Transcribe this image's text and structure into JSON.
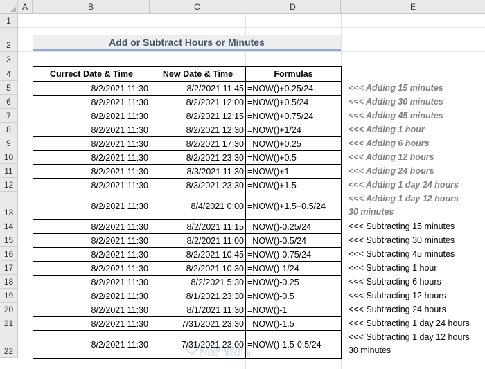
{
  "columns": [
    "A",
    "B",
    "C",
    "D",
    "E"
  ],
  "rows": [
    "1",
    "2",
    "3",
    "4",
    "5",
    "6",
    "7",
    "8",
    "9",
    "10",
    "11",
    "12",
    "13",
    "14",
    "15",
    "16",
    "17",
    "18",
    "19",
    "20",
    "21",
    "22"
  ],
  "title": "Add or Subtract Hours or Minutes",
  "table": {
    "headers": [
      "Currect Date & Time",
      "New Date & Time",
      "Formulas"
    ],
    "rows": [
      {
        "current": "8/2/2021 11:30",
        "new": "8/2/2021 11:45",
        "formula": "=NOW()+0.25/24",
        "note": "<<< Adding 15 minutes"
      },
      {
        "current": "8/2/2021 11:30",
        "new": "8/2/2021 12:00",
        "formula": "=NOW()+0.5/24",
        "note": "<<< Adding 30 minutes"
      },
      {
        "current": "8/2/2021 11:30",
        "new": "8/2/2021 12:15",
        "formula": "=NOW()+0.75/24",
        "note": "<<< Adding 45 minutes"
      },
      {
        "current": "8/2/2021 11:30",
        "new": "8/2/2021 12:30",
        "formula": "=NOW()+1/24",
        "note": "<<< Adding 1 hour"
      },
      {
        "current": "8/2/2021 11:30",
        "new": "8/2/2021 17:30",
        "formula": "=NOW()+0.25",
        "note": "<<< Adding 6 hours"
      },
      {
        "current": "8/2/2021 11:30",
        "new": "8/2/2021 23:30",
        "formula": "=NOW()+0.5",
        "note": "<<< Adding 12 hours"
      },
      {
        "current": "8/2/2021 11:30",
        "new": "8/3/2021 11:30",
        "formula": "=NOW()+1",
        "note": "<<< Adding 24 hours"
      },
      {
        "current": "8/2/2021 11:30",
        "new": "8/3/2021 23:30",
        "formula": "=NOW()+1.5",
        "note": "<<< Adding 1 day 24 hours"
      },
      {
        "current": "8/2/2021 11:30",
        "new": "8/4/2021 0:00",
        "formula": "=NOW()+1.5+0.5/24",
        "note": "<<< Adding 1 day 12 hours",
        "note2": "30 minutes"
      },
      {
        "current": "8/2/2021 11:30",
        "new": "8/2/2021 11:15",
        "formula": "=NOW()-0.25/24",
        "note": "<<< Subtracting 15 minutes"
      },
      {
        "current": "8/2/2021 11:30",
        "new": "8/2/2021 11:00",
        "formula": "=NOW()-0.5/24",
        "note": "<<< Subtracting 30 minutes"
      },
      {
        "current": "8/2/2021 11:30",
        "new": "8/2/2021 10:45",
        "formula": "=NOW()-0.75/24",
        "note": "<<< Subtracting 45 minutes"
      },
      {
        "current": "8/2/2021 11:30",
        "new": "8/2/2021 10:30",
        "formula": "=NOW()-1/24",
        "note": "<<< Subtracting 1 hour"
      },
      {
        "current": "8/2/2021 11:30",
        "new": "8/2/2021 5:30",
        "formula": "=NOW()-0.25",
        "note": "<<< Subtracting 6 hours"
      },
      {
        "current": "8/2/2021 11:30",
        "new": "8/1/2021 23:30",
        "formula": "=NOW()-0.5",
        "note": "<<< Subtracting 12 hours"
      },
      {
        "current": "8/2/2021 11:30",
        "new": "8/1/2021 11:30",
        "formula": "=NOW()-1",
        "note": "<<< Subtracting 24 hours"
      },
      {
        "current": "8/2/2021 11:30",
        "new": "7/31/2021 23:30",
        "formula": "=NOW()-1.5",
        "note": "<<< Subtracting 1 day 24 hours"
      },
      {
        "current": "8/2/2021 11:30",
        "new": "7/31/2021 23:00",
        "formula": "=NOW()-1.5-0.5/24",
        "note": "<<< Subtracting 1 day 12 hours",
        "note2": "30 minutes"
      }
    ]
  },
  "watermark": {
    "name": "exceldemy",
    "tagline": "EXCEL · DATA · BI"
  },
  "colors": {
    "header_bg": "#e9e9e9",
    "title_underline": "#8ea9db",
    "title_text": "#44546a",
    "add_note": "#7f7f7f"
  }
}
